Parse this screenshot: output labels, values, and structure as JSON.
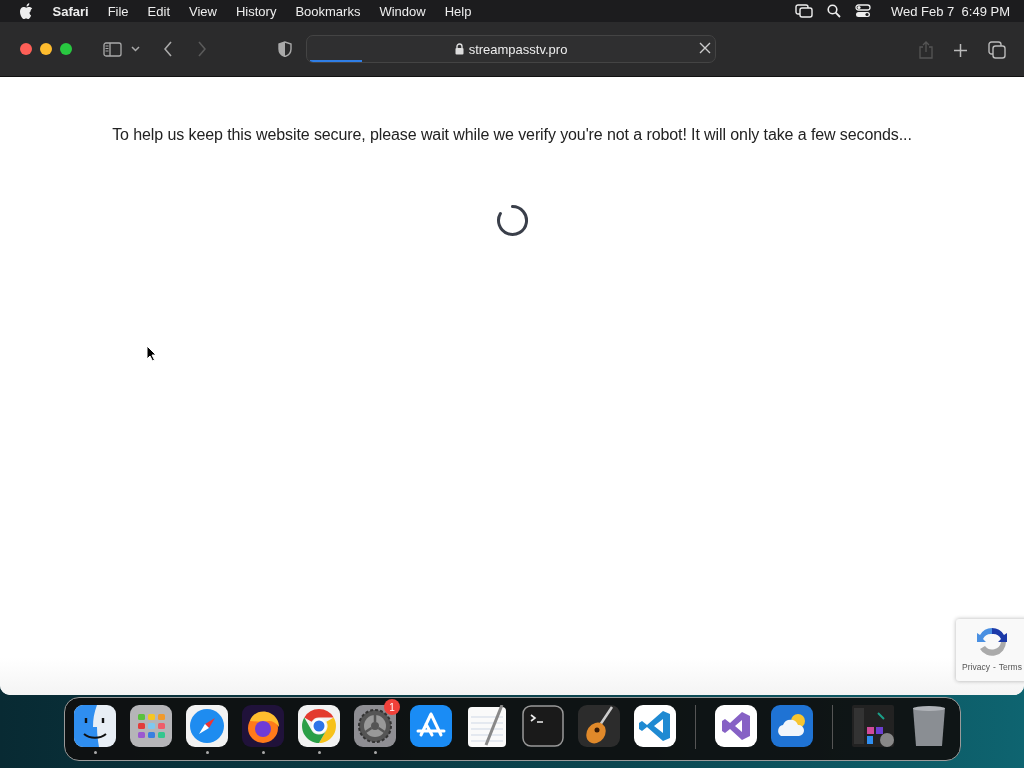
{
  "menu_bar": {
    "app": "Safari",
    "items": [
      "File",
      "Edit",
      "View",
      "History",
      "Bookmarks",
      "Window",
      "Help"
    ],
    "clock": "Wed Feb 7  6:49 PM"
  },
  "toolbar": {
    "nav": [
      {
        "kind": "back",
        "disabled": false
      },
      {
        "kind": "forward",
        "disabled": true
      }
    ],
    "address": "streampasstv.pro",
    "load_progress": {
      "level": 0.13
    },
    "share_disabled": true
  },
  "page": {
    "message": "To help us keep this website secure, please wait while we verify you're not a robot! It will only take a few seconds...",
    "recaptcha": {
      "links": [
        "Privacy",
        "Terms"
      ],
      "separator": "-"
    }
  },
  "dock": {
    "apps": [
      {
        "kind": "finder",
        "running": true
      },
      {
        "kind": "launchpad",
        "running": false
      },
      {
        "kind": "safari",
        "running": true
      },
      {
        "kind": "firefox",
        "running": true
      },
      {
        "kind": "chrome",
        "running": true
      },
      {
        "kind": "settings",
        "running": true,
        "badge": "1"
      },
      {
        "kind": "appstore",
        "running": false
      },
      {
        "kind": "textedit",
        "running": false
      },
      {
        "kind": "terminal",
        "running": false
      },
      {
        "kind": "garageband",
        "running": false
      },
      {
        "kind": "vscode",
        "running": false
      },
      {
        "kind": "divider"
      },
      {
        "kind": "visualstudio",
        "running": false
      },
      {
        "kind": "weather",
        "running": false
      },
      {
        "kind": "divider"
      },
      {
        "kind": "thumbnail",
        "running": false
      },
      {
        "kind": "trash",
        "running": false
      }
    ]
  }
}
